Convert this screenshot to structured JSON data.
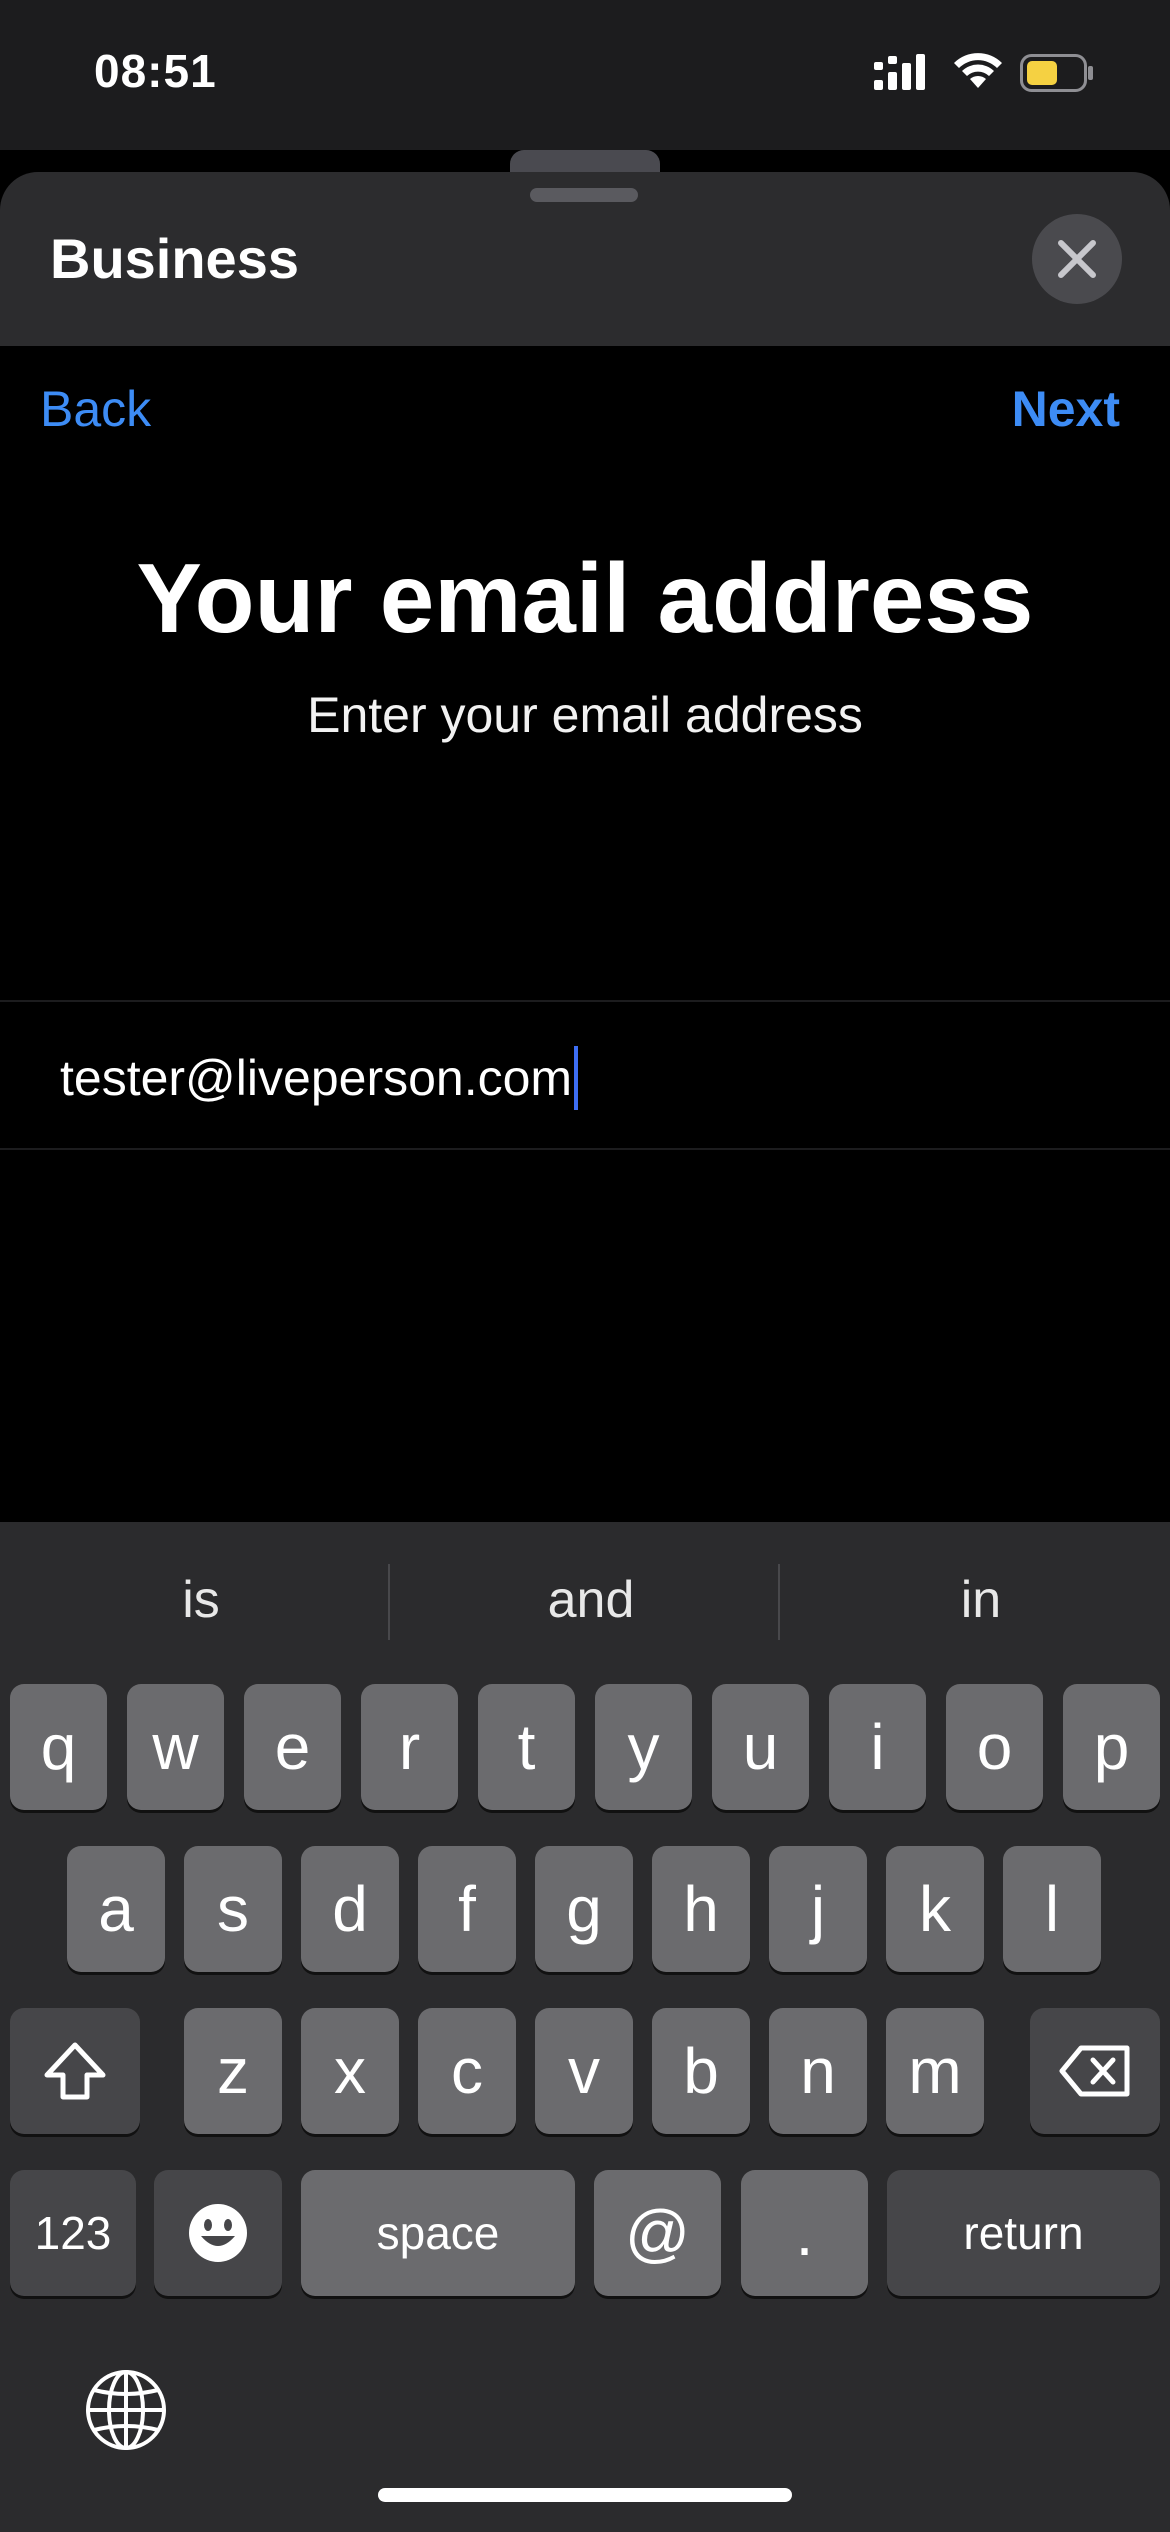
{
  "status_bar": {
    "time": "08:51",
    "icons": [
      "signal-icon",
      "wifi-icon",
      "battery-icon"
    ],
    "battery_color": "#f5d142"
  },
  "sheet": {
    "title": "Business"
  },
  "nav": {
    "back_label": "Back",
    "next_label": "Next",
    "accent_color": "#3d8cf5"
  },
  "page": {
    "title": "Your email address",
    "subtitle": "Enter your email address"
  },
  "email_field": {
    "value": "tester@liveperson.com"
  },
  "keyboard": {
    "suggestions": [
      "is",
      "and",
      "in"
    ],
    "row1": [
      "q",
      "w",
      "e",
      "r",
      "t",
      "y",
      "u",
      "i",
      "o",
      "p"
    ],
    "row2": [
      "a",
      "s",
      "d",
      "f",
      "g",
      "h",
      "j",
      "k",
      "l"
    ],
    "row3": [
      "z",
      "x",
      "c",
      "v",
      "b",
      "n",
      "m"
    ],
    "numbers_label": "123",
    "space_label": "space",
    "at_label": "@",
    "dot_label": ".",
    "return_label": "return"
  }
}
